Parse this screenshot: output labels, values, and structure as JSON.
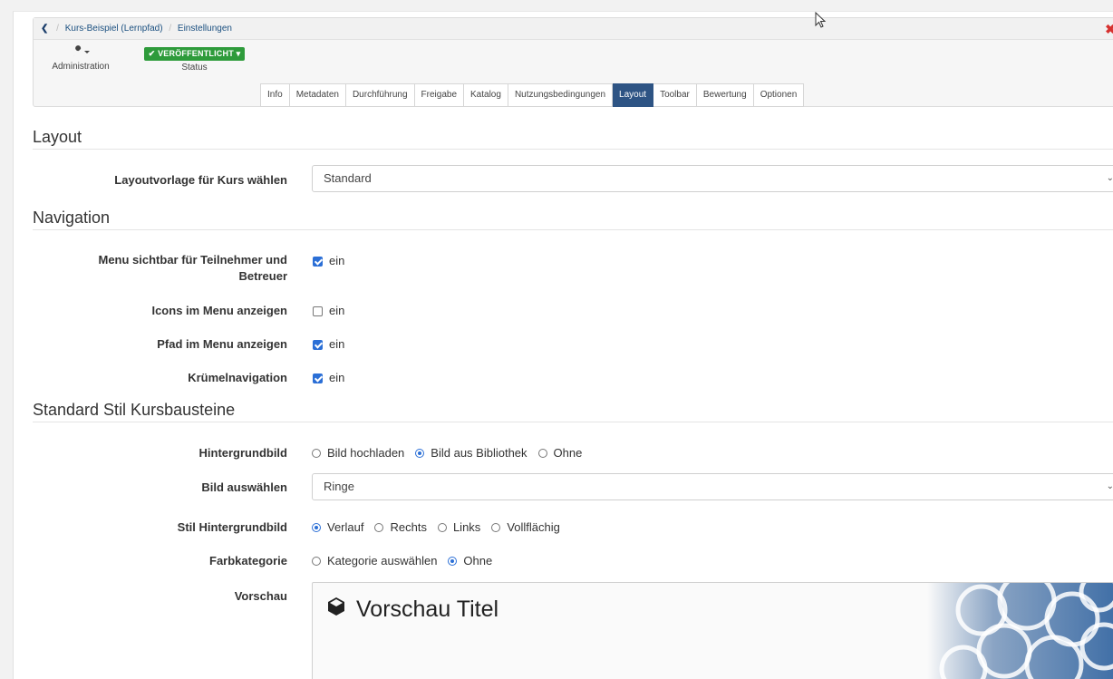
{
  "breadcrumb": {
    "back_icon": "chevron-left-icon",
    "items": [
      "Kurs-Beispiel (Lernpfad)",
      "Einstellungen"
    ],
    "close_icon": "close-icon"
  },
  "toolbar": {
    "admin_icon": "wrench-icon",
    "admin_label": "Administration",
    "status_badge": "VERÖFFENTLICHT",
    "status_label": "Status"
  },
  "tabs": [
    {
      "label": "Info"
    },
    {
      "label": "Metadaten"
    },
    {
      "label": "Durchführung"
    },
    {
      "label": "Freigabe"
    },
    {
      "label": "Katalog"
    },
    {
      "label": "Nutzungsbedingungen"
    },
    {
      "label": "Layout",
      "active": true
    },
    {
      "label": "Toolbar"
    },
    {
      "label": "Bewertung"
    },
    {
      "label": "Optionen"
    }
  ],
  "layout": {
    "heading": "Layout",
    "template_label": "Layoutvorlage für Kurs wählen",
    "template_value": "Standard"
  },
  "navigation": {
    "heading": "Navigation",
    "menu_visible_label": "Menu sichtbar für Teilnehmer und Betreuer",
    "menu_visible_value": "ein",
    "icons_label": "Icons im Menu anzeigen",
    "icons_value": "ein",
    "path_label": "Pfad im Menu anzeigen",
    "path_value": "ein",
    "crumb_label": "Krümelnavigation",
    "crumb_value": "ein"
  },
  "style": {
    "heading": "Standard Stil Kursbausteine",
    "bg_label": "Hintergrundbild",
    "bg_options": [
      "Bild hochladen",
      "Bild aus Bibliothek",
      "Ohne"
    ],
    "image_label": "Bild auswählen",
    "image_value": "Ringe",
    "bg_style_label": "Stil Hintergrundbild",
    "bg_style_options": [
      "Verlauf",
      "Rechts",
      "Links",
      "Vollflächig"
    ],
    "color_label": "Farbkategorie",
    "color_options": [
      "Kategorie auswählen",
      "Ohne"
    ],
    "preview_label": "Vorschau",
    "preview_title": "Vorschau Titel",
    "preview_icon": "cube-icon"
  },
  "colors": {
    "accent": "#2e5484",
    "status_green": "#2e9b3b",
    "checkbox_blue": "#2b6fd6",
    "close_red": "#d6302e"
  }
}
